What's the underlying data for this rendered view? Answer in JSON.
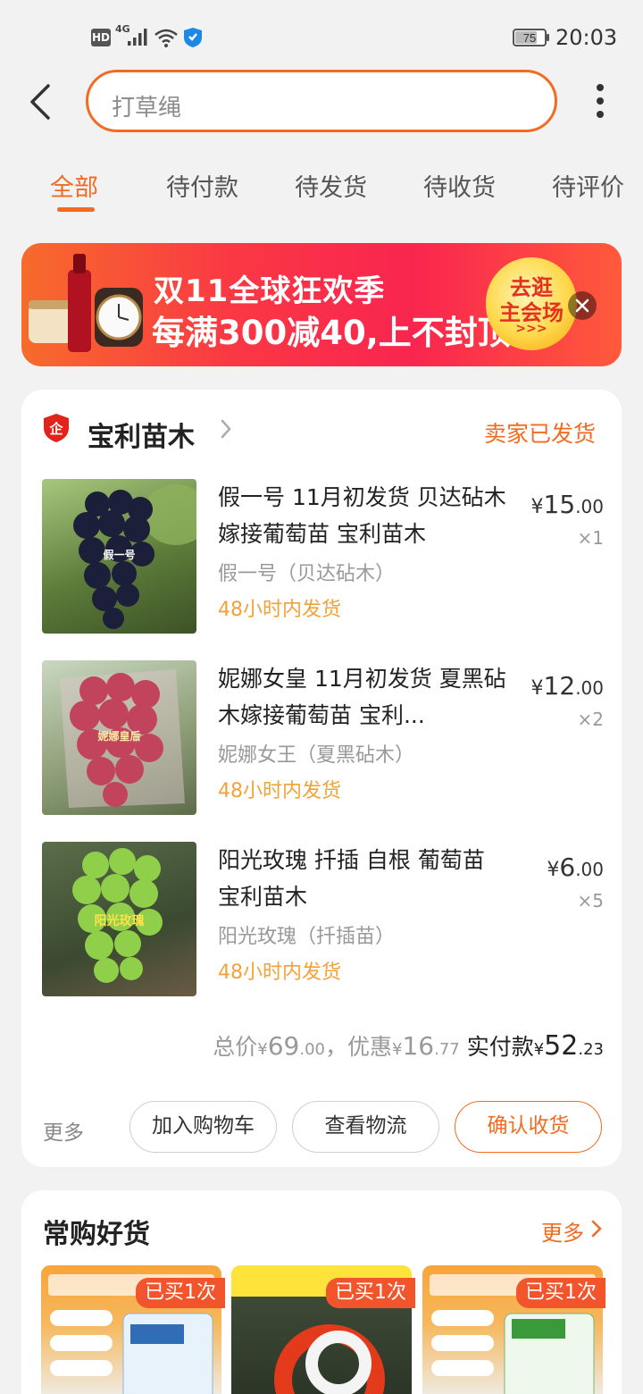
{
  "status_bar": {
    "hd": "HD",
    "network": "4G",
    "battery": "75",
    "time": "20:03"
  },
  "search": {
    "query": "打草绳"
  },
  "tabs": [
    {
      "label": "全部",
      "active": true
    },
    {
      "label": "待付款"
    },
    {
      "label": "待发货"
    },
    {
      "label": "待收货"
    },
    {
      "label": "待评价"
    }
  ],
  "banner": {
    "title": "双11全球狂欢季",
    "subtitle": "每满300减40,上不封顶",
    "cta_line1": "去逛",
    "cta_line2": "主会场",
    "cta_arrows": ">>>"
  },
  "order": {
    "shop_name": "宝利苗木",
    "status": "卖家已发货",
    "items": [
      {
        "thumb_label": "假一号",
        "title": "假一号 11月初发货 贝达砧木嫁接葡萄苗 宝利苗木",
        "spec": "假一号（贝达砧木）",
        "shipping": "48小时内发货",
        "price_yen": "¥",
        "price_int": "15",
        "price_dec": ".00",
        "qty": "×1"
      },
      {
        "thumb_label": "妮娜皇后",
        "title": "妮娜女皇 11月初发货 夏黑砧木嫁接葡萄苗 宝利...",
        "spec": "妮娜女王（夏黑砧木）",
        "shipping": "48小时内发货",
        "price_yen": "¥",
        "price_int": "12",
        "price_dec": ".00",
        "qty": "×2"
      },
      {
        "thumb_label": "阳光玫瑰",
        "title": "阳光玫瑰 扦插 自根 葡萄苗 宝利苗木",
        "spec": "阳光玫瑰（扦插苗）",
        "shipping": "48小时内发货",
        "price_yen": "¥",
        "price_int": "6",
        "price_dec": ".00",
        "qty": "×5"
      }
    ],
    "totals": {
      "total_label": "总价",
      "total_yen": "¥",
      "total_int": "69",
      "total_dec": ".00",
      "sep": "，",
      "discount_label": "优惠",
      "discount_yen": "¥",
      "discount_int": "16",
      "discount_dec": ".77",
      "paid_label": "实付款",
      "paid_yen": "¥",
      "paid_int": "52",
      "paid_dec": ".23"
    },
    "actions": {
      "more": "更多",
      "add_cart": "加入购物车",
      "view_logistics": "查看物流",
      "confirm_receipt": "确认收货"
    }
  },
  "frequent": {
    "title": "常购好货",
    "more": "更多",
    "items": [
      {
        "badge": "已买1次"
      },
      {
        "badge": "已买1次"
      },
      {
        "badge": "已买1次"
      }
    ]
  },
  "colors": {
    "accent": "#f26b21",
    "shipping": "#f2a238",
    "banner_red": "#fa3844",
    "badge": "#f2552c"
  }
}
